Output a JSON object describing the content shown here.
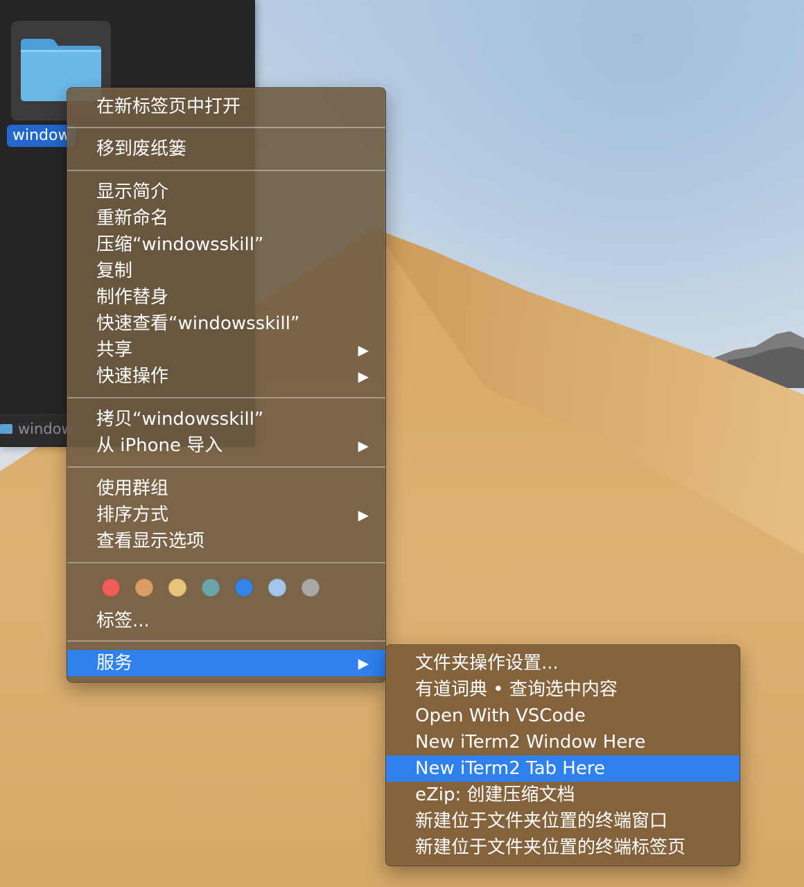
{
  "finder": {
    "file_label": "window",
    "status_label": "window"
  },
  "context_menu": {
    "open_new_tab": "在新标签页中打开",
    "move_to_trash": "移到废纸篓",
    "get_info": "显示简介",
    "rename": "重新命名",
    "compress": "压缩“windowsskill”",
    "duplicate": "复制",
    "make_alias": "制作替身",
    "quick_look": "快速查看“windowsskill”",
    "share": "共享",
    "quick_actions": "快速操作",
    "copy": "拷贝“windowsskill”",
    "import_iphone": "从 iPhone 导入",
    "use_groups": "使用群组",
    "sort_by": "排序方式",
    "view_options": "查看显示选项",
    "tags": "标签...",
    "services": "服务",
    "submenu_arrow": "▶"
  },
  "tag_colors": [
    "#f25d5a",
    "#d99f62",
    "#e8c57d",
    "#6aa6a8",
    "#3185e6",
    "#a5c6ea",
    "#a9a9a9"
  ],
  "services_submenu": {
    "items": [
      "文件夹操作设置...",
      "有道词典 • 查询选中内容",
      "Open With VSCode",
      "New iTerm2 Window Here",
      "New iTerm2 Tab Here",
      "eZip: 创建压缩文档",
      "新建位于文件夹位置的终端窗口",
      "新建位于文件夹位置的终端标签页"
    ],
    "highlighted": "New iTerm2 Tab Here"
  },
  "colors": {
    "highlight": "#2f81ee",
    "menu_bg": "#705c42"
  }
}
